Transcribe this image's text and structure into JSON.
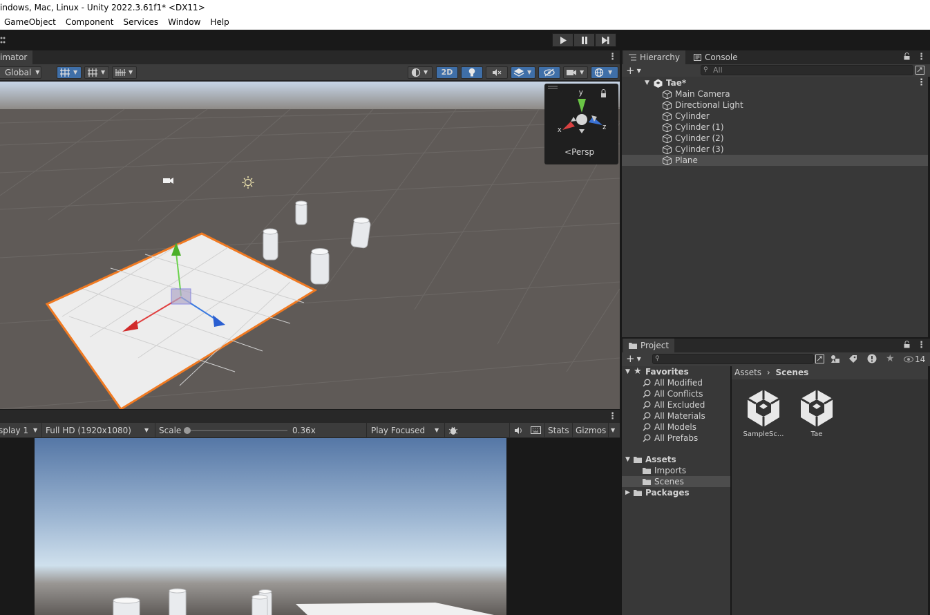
{
  "window": {
    "title": "indows, Mac, Linux - Unity 2022.3.61f1* <DX11>"
  },
  "menu": [
    "GameObject",
    "Component",
    "Services",
    "Window",
    "Help"
  ],
  "play_controls": {
    "play": "▶",
    "pause": "❚❚",
    "step": "▶❘"
  },
  "scene": {
    "tab_label": "imator",
    "global_label": "Global",
    "mode_2d": "2D",
    "persp_label": "Persp",
    "axis_labels": {
      "x": "x",
      "y": "y",
      "z": "z"
    }
  },
  "game": {
    "display_label": "splay 1",
    "resolution": "Full HD (1920x1080)",
    "scale_label": "Scale",
    "scale_value": "0.36x",
    "scale_fraction": 0.0,
    "play_mode": "Play Focused",
    "stats": "Stats",
    "gizmos": "Gizmos"
  },
  "hierarchy": {
    "tab_label": "Hierarchy",
    "console_tab": "Console",
    "search_placeholder": "All",
    "scene_name": "Tae*",
    "items": [
      {
        "label": "Main Camera",
        "selected": false
      },
      {
        "label": "Directional Light",
        "selected": false
      },
      {
        "label": "Cylinder",
        "selected": false
      },
      {
        "label": "Cylinder (1)",
        "selected": false
      },
      {
        "label": "Cylinder (2)",
        "selected": false
      },
      {
        "label": "Cylinder (3)",
        "selected": false
      },
      {
        "label": "Plane",
        "selected": true
      }
    ]
  },
  "project": {
    "tab_label": "Project",
    "hidden_count": "14",
    "favorites_label": "Favorites",
    "favorites": [
      "All Modified",
      "All Conflicts",
      "All Excluded",
      "All Materials",
      "All Models",
      "All Prefabs"
    ],
    "assets_label": "Assets",
    "asset_folders": [
      {
        "label": "Imports",
        "selected": false
      },
      {
        "label": "Scenes",
        "selected": true
      }
    ],
    "packages_label": "Packages",
    "breadcrumb": {
      "root": "Assets",
      "current": "Scenes"
    },
    "files": [
      "SampleSc...",
      "Tae"
    ]
  }
}
